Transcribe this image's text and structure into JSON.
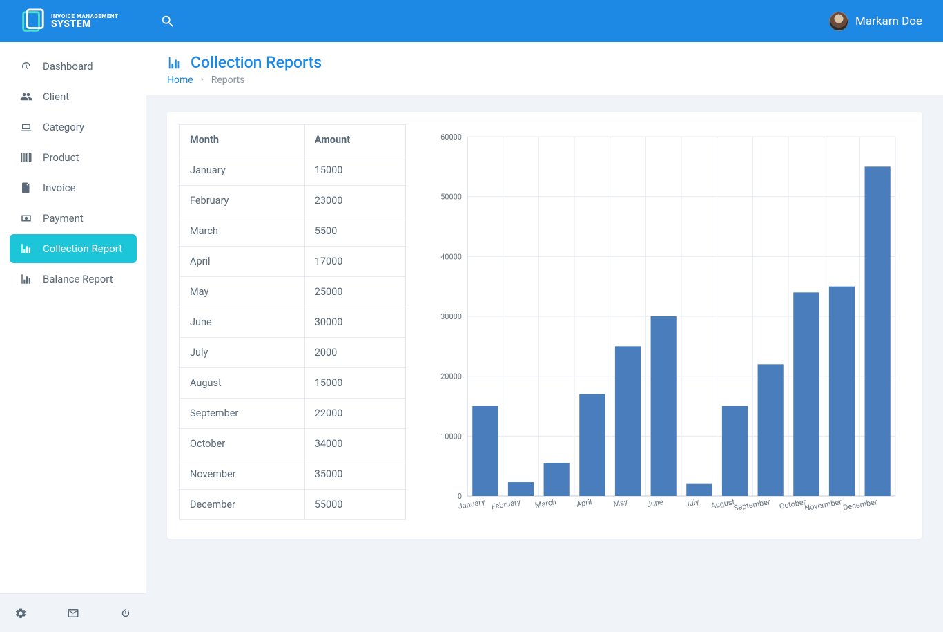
{
  "app": {
    "logo_line1": "INVOICE MANAGEMENT",
    "logo_line2": "SYSTEM",
    "user_name": "Markarn Doe"
  },
  "sidebar": {
    "items": [
      {
        "label": "Dashboard",
        "icon": "gauge"
      },
      {
        "label": "Client",
        "icon": "people"
      },
      {
        "label": "Category",
        "icon": "laptop"
      },
      {
        "label": "Product",
        "icon": "barcode"
      },
      {
        "label": "Invoice",
        "icon": "file"
      },
      {
        "label": "Payment",
        "icon": "money"
      },
      {
        "label": "Collection Report",
        "icon": "barchart",
        "active": true
      },
      {
        "label": "Balance Report",
        "icon": "barchart"
      }
    ]
  },
  "page": {
    "title": "Collection Reports",
    "breadcrumb_home": "Home",
    "breadcrumb_current": "Reports"
  },
  "table": {
    "header_month": "Month",
    "header_amount": "Amount",
    "rows": [
      {
        "month": "January",
        "amount": "15000"
      },
      {
        "month": "February",
        "amount": "23000"
      },
      {
        "month": "March",
        "amount": "5500"
      },
      {
        "month": "April",
        "amount": "17000"
      },
      {
        "month": "May",
        "amount": "25000"
      },
      {
        "month": "June",
        "amount": "30000"
      },
      {
        "month": "July",
        "amount": "2000"
      },
      {
        "month": "August",
        "amount": "15000"
      },
      {
        "month": "September",
        "amount": "22000"
      },
      {
        "month": "October",
        "amount": "34000"
      },
      {
        "month": "November",
        "amount": "35000"
      },
      {
        "month": "December",
        "amount": "55000"
      }
    ]
  },
  "chart_data": {
    "type": "bar",
    "categories": [
      "January",
      "February",
      "March",
      "April",
      "May",
      "June",
      "July",
      "August",
      "September",
      "October",
      "November",
      "December"
    ],
    "x_display_labels": [
      "January",
      "February",
      "March",
      "April",
      "May",
      "June",
      "July",
      "August",
      "September",
      "October",
      "Novermber",
      "December"
    ],
    "values": [
      15000,
      2300,
      5500,
      17000,
      25000,
      30000,
      2000,
      15000,
      22000,
      34000,
      35000,
      55000
    ],
    "y_ticks": [
      0,
      10000,
      20000,
      30000,
      40000,
      50000,
      60000
    ],
    "ylim": [
      0,
      60000
    ],
    "title": "",
    "xlabel": "",
    "ylabel": ""
  }
}
